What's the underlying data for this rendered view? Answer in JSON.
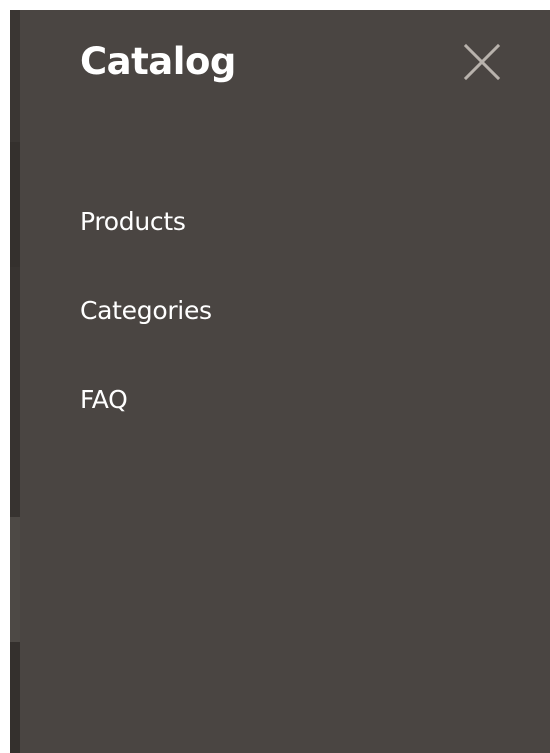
{
  "panel": {
    "title": "Catalog",
    "close_icon": "close-icon",
    "background_color": "#4a4542",
    "text_color": "#ffffff",
    "icon_color": "#b8b2ac"
  },
  "menu": {
    "items": [
      {
        "label": "Products"
      },
      {
        "label": "Categories"
      },
      {
        "label": "FAQ"
      }
    ]
  }
}
